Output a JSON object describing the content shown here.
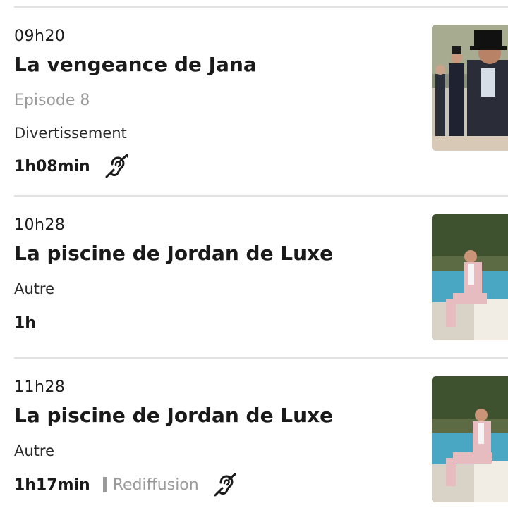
{
  "programs": [
    {
      "time": "09h20",
      "title": "La vengeance de Jana",
      "subtitle": "Episode 8",
      "category": "Divertissement",
      "duration": "1h08min",
      "rediffusion": "",
      "icons": [
        "hearing-impaired-icon"
      ]
    },
    {
      "time": "10h28",
      "title": "La piscine de Jordan de Luxe",
      "subtitle": "",
      "category": "Autre",
      "duration": "1h",
      "rediffusion": "",
      "icons": []
    },
    {
      "time": "11h28",
      "title": "La piscine de Jordan de Luxe",
      "subtitle": "",
      "category": "Autre",
      "duration": "1h17min",
      "rediffusion": "Rediffusion",
      "icons": [
        "hearing-impaired-icon"
      ]
    }
  ],
  "colors": {
    "divider": "#e2e2e2",
    "muted_text": "#9a9a9a",
    "primary_text": "#1a1a1a"
  }
}
